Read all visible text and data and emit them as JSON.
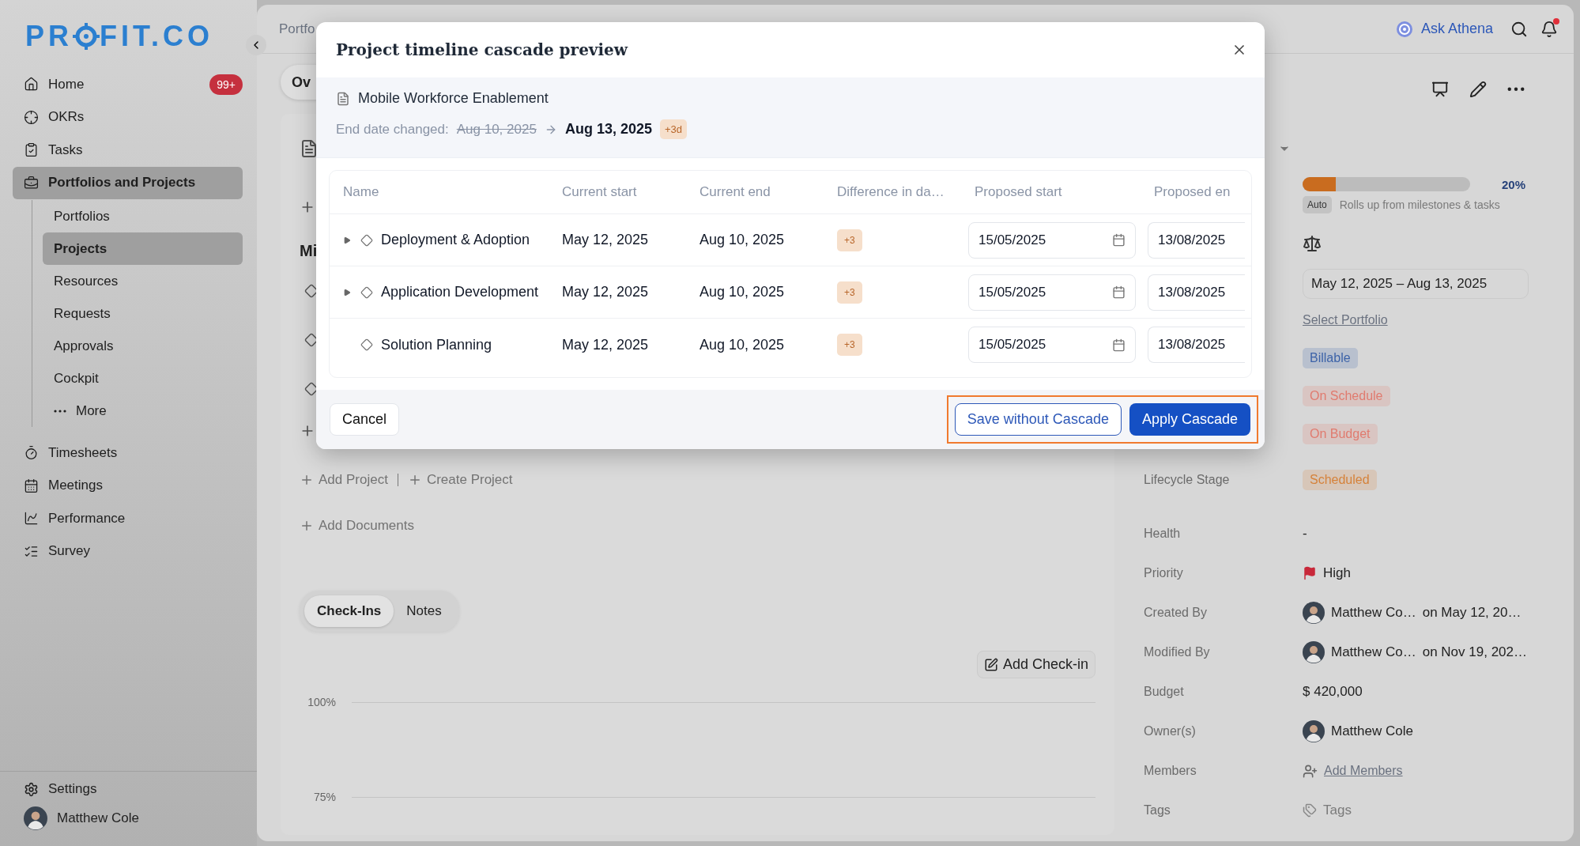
{
  "sidebar": {
    "logo": {
      "before": "PR",
      "after": "FIT.CO"
    },
    "nav": [
      {
        "label": "Home",
        "badge": "99+",
        "selected": false
      },
      {
        "label": "OKRs",
        "selected": false
      },
      {
        "label": "Tasks",
        "selected": false
      },
      {
        "label": "Portfolios and Projects",
        "selected": true,
        "expanded": true,
        "children": [
          {
            "label": "Portfolios",
            "selected": false
          },
          {
            "label": "Projects",
            "selected": true
          },
          {
            "label": "Resources",
            "selected": false
          },
          {
            "label": "Requests",
            "selected": false
          },
          {
            "label": "Approvals",
            "selected": false
          },
          {
            "label": "Cockpit",
            "selected": false
          },
          {
            "label": "More",
            "kind": "more",
            "selected": false
          }
        ]
      },
      {
        "label": "Timesheets",
        "selected": false
      },
      {
        "label": "Meetings",
        "selected": false
      },
      {
        "label": "Performance",
        "selected": false
      },
      {
        "label": "Survey",
        "selected": false
      }
    ],
    "settings": "Settings",
    "user": "Matthew Cole"
  },
  "topbar": {
    "breadcrumb": "Portfo",
    "ask": "Ask Athena",
    "unread": true
  },
  "main": {
    "tab": "Ov",
    "section": "Mi",
    "links": [
      "Add Project",
      "Create Project"
    ],
    "add_documents": "Add Documents",
    "checkin_tabs": [
      {
        "label": "Check-Ins",
        "selected": true
      },
      {
        "label": "Notes",
        "selected": false
      }
    ],
    "add_checkin": "Add Check-in",
    "chart_ticks": [
      "100%",
      "75%"
    ]
  },
  "right_panel": {
    "progress": {
      "level": 0.2,
      "reading": "20%",
      "auto": "Auto",
      "note": "Rolls up from milestones & tasks"
    },
    "date_range": "May 12, 2025 – Aug 13, 2025",
    "portfolio_link": "Select Portfolio",
    "chips": [
      {
        "label": "Billable",
        "color": "#3d63a8"
      },
      {
        "label": "On Schedule",
        "color": "#e07b6f"
      },
      {
        "label": "On Budget",
        "color": "#e07b6f"
      }
    ],
    "fields": [
      {
        "label": "Lifecycle Stage",
        "kind": "chip",
        "value": "Scheduled",
        "color": "#d5823a"
      },
      {
        "label": "Health",
        "kind": "text",
        "value": "-"
      },
      {
        "label": "Priority",
        "kind": "flag",
        "value": "High"
      },
      {
        "label": "Created By",
        "kind": "person",
        "value": "Matthew Co…",
        "date": "on May 12, 20…"
      },
      {
        "label": "Modified By",
        "kind": "person",
        "value": "Matthew Co…",
        "date": "on Nov 19, 202…"
      },
      {
        "label": "Budget",
        "kind": "text",
        "value": "$ 420,000"
      },
      {
        "label": "Owner(s)",
        "kind": "person",
        "value": "Matthew Cole"
      },
      {
        "label": "Members",
        "kind": "add_members",
        "value": "Add Members"
      },
      {
        "label": "Tags",
        "kind": "tags",
        "value": "Tags"
      }
    ]
  },
  "modal": {
    "title": "Project timeline cascade preview",
    "project": "Mobile Workforce Enablement",
    "change": {
      "label": "End date changed:",
      "old": "Aug 10, 2025",
      "new": "Aug 13, 2025",
      "delta": "+3d"
    },
    "columns": [
      "Name",
      "Current start",
      "Current end",
      "Difference in da…",
      "Proposed start",
      "Proposed en"
    ],
    "rows": [
      {
        "name": "Deployment & Adoption",
        "expandable": true,
        "current_start": "May 12, 2025",
        "current_end": "Aug 10, 2025",
        "difference": "+3",
        "proposed_start": "15/05/2025",
        "proposed_end": "13/08/2025"
      },
      {
        "name": "Application Development",
        "expandable": true,
        "current_start": "May 12, 2025",
        "current_end": "Aug 10, 2025",
        "difference": "+3",
        "proposed_start": "15/05/2025",
        "proposed_end": "13/08/2025"
      },
      {
        "name": "Solution Planning",
        "expandable": false,
        "current_start": "May 12, 2025",
        "current_end": "Aug 10, 2025",
        "difference": "+3",
        "proposed_start": "15/05/2025",
        "proposed_end": "13/08/2025"
      }
    ],
    "cancel": "Cancel",
    "save": "Save without Cascade",
    "apply": "Apply Cascade",
    "highlighted": true
  }
}
